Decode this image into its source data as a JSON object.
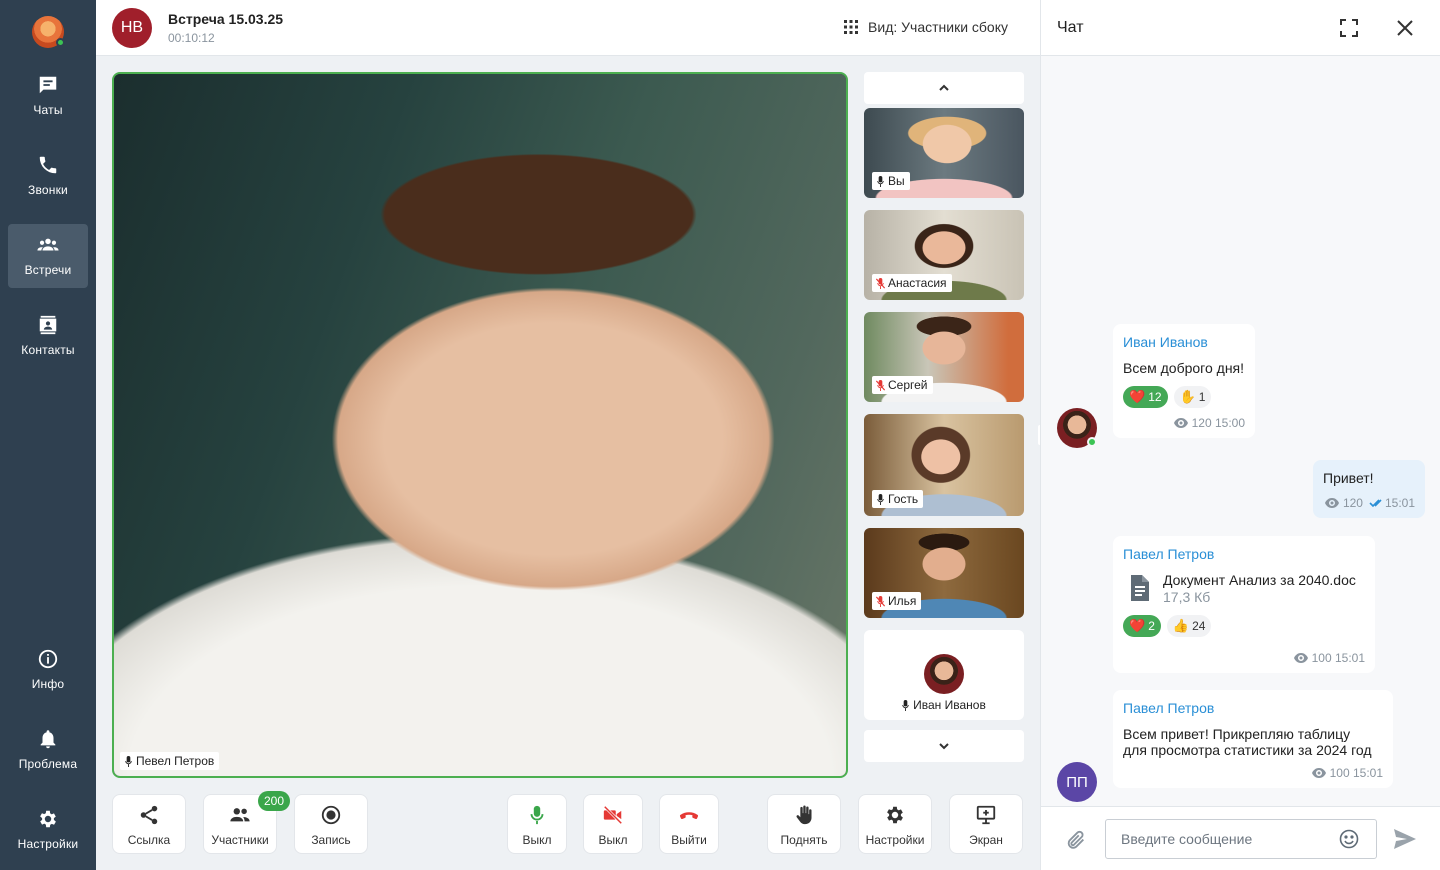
{
  "sidebar": {
    "items": [
      {
        "label": "Чаты",
        "icon": "chat-icon"
      },
      {
        "label": "Звонки",
        "icon": "phone-icon"
      },
      {
        "label": "Встречи",
        "icon": "group-icon"
      },
      {
        "label": "Контакты",
        "icon": "contacts-icon"
      },
      {
        "label": "Инфо",
        "icon": "info-icon"
      },
      {
        "label": "Проблема",
        "icon": "bell-icon"
      },
      {
        "label": "Настройки",
        "icon": "gear-icon"
      }
    ]
  },
  "header": {
    "initials": "НВ",
    "title": "Встреча 15.03.25",
    "duration": "00:10:12",
    "view_label": "Вид: Участники сбоку"
  },
  "stage": {
    "speaker_name": "Певел Петров"
  },
  "participants": [
    {
      "name": "Вы",
      "muted": false
    },
    {
      "name": "Анастасия",
      "muted": true
    },
    {
      "name": "Сергей",
      "muted": true
    },
    {
      "name": "Гость",
      "muted": false
    },
    {
      "name": "Илья",
      "muted": true
    },
    {
      "name": "Иван Иванов",
      "muted": false
    }
  ],
  "toolbar": {
    "link": "Ссылка",
    "participants": "Участники",
    "participants_count": "200",
    "record": "Запись",
    "mic": "Выкл",
    "camera": "Выкл",
    "leave": "Выйти",
    "raise": "Поднять",
    "settings": "Настройки",
    "screen": "Экран"
  },
  "chat": {
    "title": "Чат",
    "input_placeholder": "Введите сообщение",
    "messages": [
      {
        "author": "Иван Иванов",
        "text": "Всем доброго дня!",
        "reactions": [
          {
            "emoji": "❤️",
            "count": "12",
            "active": true
          },
          {
            "emoji": "✋",
            "count": "1",
            "active": false
          }
        ],
        "views": "120",
        "time": "15:00"
      },
      {
        "text": "Привет!",
        "views": "120",
        "time": "15:01"
      },
      {
        "author": "Павел Петров",
        "doc_name": "Документ Анализ за 2040.doc",
        "doc_size": "17,3 Кб",
        "reactions": [
          {
            "emoji": "❤️",
            "count": "2",
            "active": true
          },
          {
            "emoji": "👍",
            "count": "24",
            "active": false
          }
        ],
        "views": "100",
        "time": "15:01"
      },
      {
        "author": "Павел Петров",
        "initials": "ПП",
        "text_line1": "Всем привет! Прикрепляю таблицу",
        "text_line2": "для просмотра статистики за 2024 год",
        "views": "100",
        "time": "15:01"
      }
    ]
  },
  "colors": {
    "sidebar": "#2f4050",
    "accent_green": "#4caf50",
    "link_blue": "#2a8fd6",
    "danger_red": "#e53935"
  }
}
